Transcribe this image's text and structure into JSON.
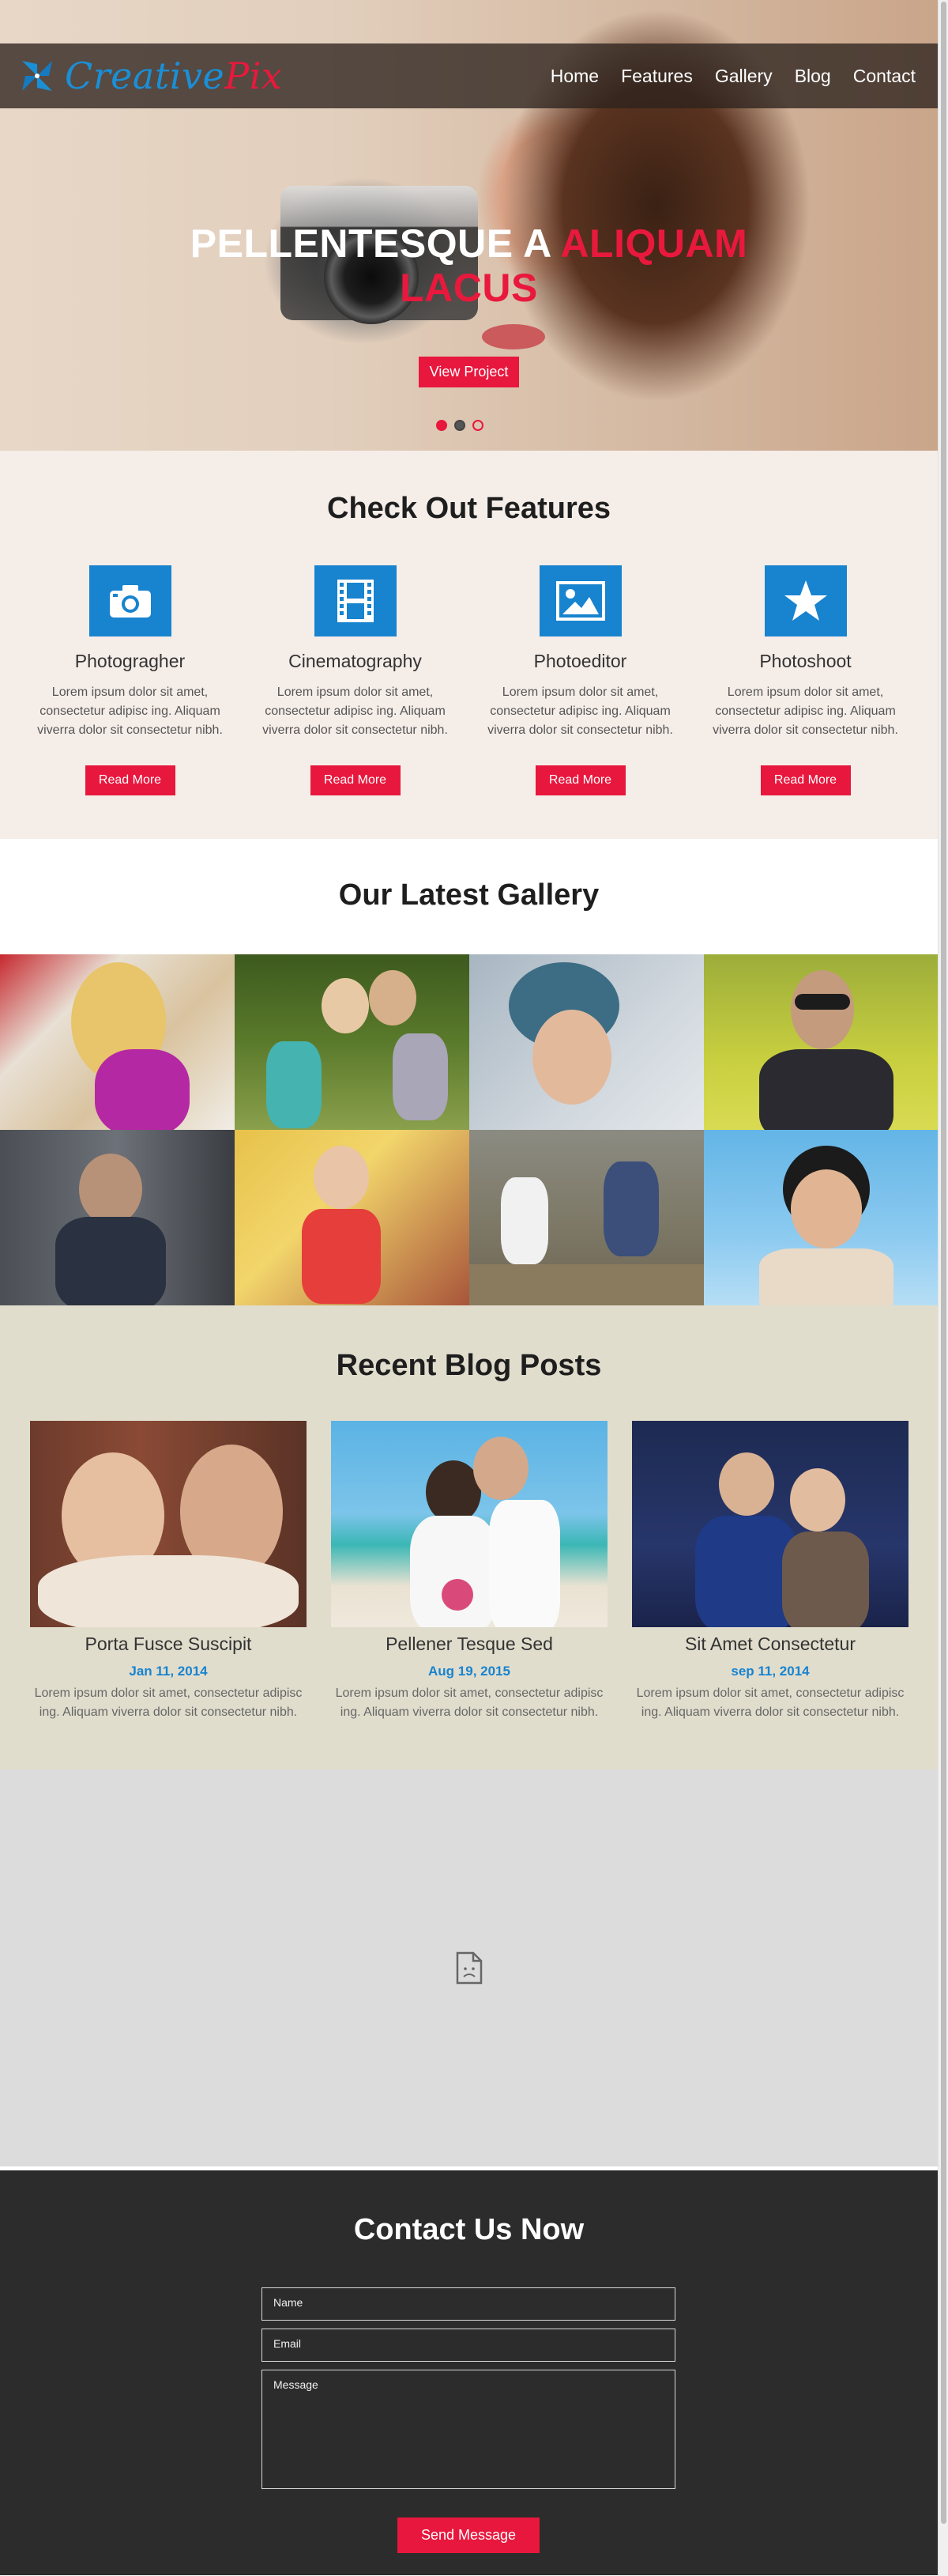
{
  "brand": {
    "part1": "Creative",
    "part2": "Pix"
  },
  "nav": [
    "Home",
    "Features",
    "Gallery",
    "Blog",
    "Contact"
  ],
  "hero": {
    "title_white": "PELLENTESQUE A",
    "title_red_1": "ALIQUAM",
    "title_red_2": "LACUS",
    "button": "View Project",
    "slides": 3,
    "active_slide": 1
  },
  "features": {
    "title": "Check Out Features",
    "items": [
      {
        "icon": "camera-icon",
        "title": "Photogragher",
        "text": "Lorem ipsum dolor sit amet, consectetur adipisc ing. Aliquam viverra dolor sit consectetur nibh.",
        "button": "Read More"
      },
      {
        "icon": "film-icon",
        "title": "Cinematography",
        "text": "Lorem ipsum dolor sit amet, consectetur adipisc ing. Aliquam viverra dolor sit consectetur nibh.",
        "button": "Read More"
      },
      {
        "icon": "picture-icon",
        "title": "Photoeditor",
        "text": "Lorem ipsum dolor sit amet, consectetur adipisc ing. Aliquam viverra dolor sit consectetur nibh.",
        "button": "Read More"
      },
      {
        "icon": "star-icon",
        "title": "Photoshoot",
        "text": "Lorem ipsum dolor sit amet, consectetur adipisc ing. Aliquam viverra dolor sit consectetur nibh.",
        "button": "Read More"
      }
    ]
  },
  "gallery": {
    "title": "Our Latest Gallery",
    "count": 8
  },
  "blog": {
    "title": "Recent Blog Posts",
    "posts": [
      {
        "title": "Porta Fusce Suscipit",
        "date": "Jan 11, 2014",
        "text": "Lorem ipsum dolor sit amet, consectetur adipisc ing. Aliquam viverra dolor sit consectetur nibh."
      },
      {
        "title": "Pellener Tesque Sed",
        "date": "Aug 19, 2015",
        "text": "Lorem ipsum dolor sit amet, consectetur adipisc ing. Aliquam viverra dolor sit consectetur nibh."
      },
      {
        "title": "Sit Amet Consectetur",
        "date": "sep 11, 2014",
        "text": "Lorem ipsum dolor sit amet, consectetur adipisc ing. Aliquam viverra dolor sit consectetur nibh."
      }
    ]
  },
  "map": {
    "icon": "broken-page-icon"
  },
  "contact": {
    "title": "Contact Us Now",
    "name_placeholder": "Name",
    "email_placeholder": "Email",
    "message_placeholder": "Message",
    "button": "Send Message"
  },
  "colors": {
    "accent_red": "#e8173d",
    "accent_blue": "#1883cf"
  }
}
